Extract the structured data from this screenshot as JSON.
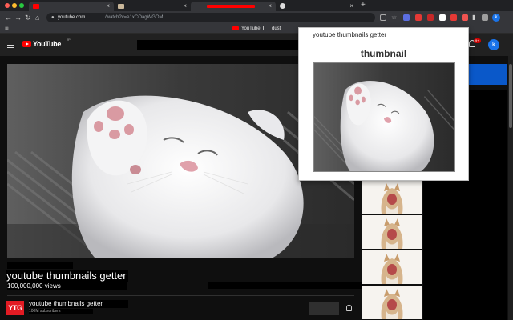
{
  "browser": {
    "tabs": [
      {
        "close": "×"
      },
      {
        "close": "×"
      },
      {
        "close": "×"
      },
      {
        "close": "×"
      }
    ],
    "new_tab": "+",
    "nav": {
      "back": "←",
      "forward": "→",
      "reload": "↻",
      "home": "⌂"
    },
    "url_host": "youtube.com",
    "url_path": "/watch?v=e1xCOagWGOM",
    "profile_initial": "k",
    "menu": "⋮",
    "bookmarks": [
      {
        "label": "YouTube",
        "icon": "youtube-icon"
      },
      {
        "label": "dust",
        "icon": "folder-icon"
      }
    ]
  },
  "youtube": {
    "logo_text": "YouTube",
    "logo_region": "JP",
    "notification_count": "9+",
    "avatar_initial": "k"
  },
  "video": {
    "title": "youtube thumbnails getter",
    "views": "100,000,000 views"
  },
  "channel": {
    "avatar_text": "YTG",
    "name": "youtube thumbnails getter",
    "subscribers": "100M subscribers"
  },
  "popup": {
    "title": "youtube thumbnails getter",
    "heading": "thumbnail"
  },
  "colors": {
    "brand_red": "#ff0000",
    "page_bg": "#0f0f0f",
    "channel_red": "#e31b23",
    "accent_blue": "#1a73e8"
  }
}
